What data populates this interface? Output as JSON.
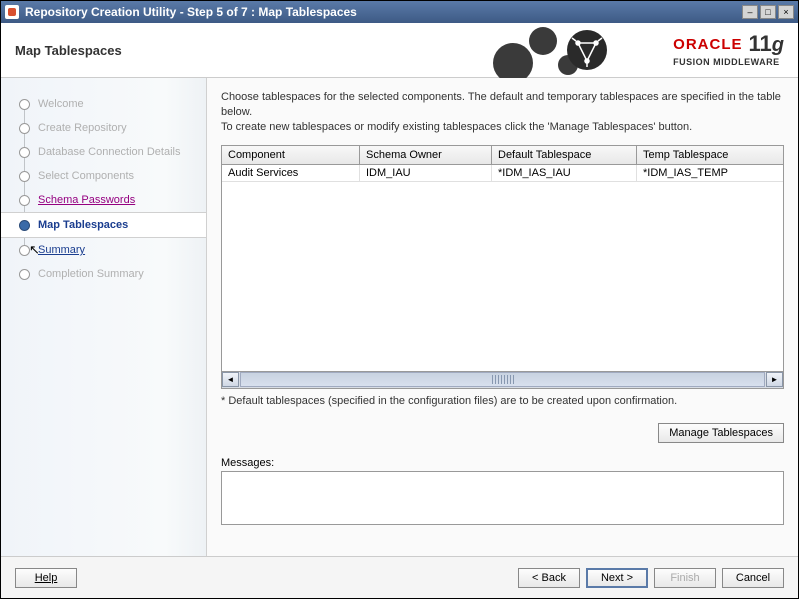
{
  "window": {
    "title": "Repository Creation Utility - Step 5 of 7 : Map Tablespaces"
  },
  "header": {
    "title": "Map Tablespaces",
    "brand": "ORACLE",
    "version": "11",
    "version_suffix": "g",
    "subtitle": "FUSION MIDDLEWARE"
  },
  "steps": [
    {
      "label": "Welcome",
      "state": "completed"
    },
    {
      "label": "Create Repository",
      "state": "completed"
    },
    {
      "label": "Database Connection Details",
      "state": "completed"
    },
    {
      "label": "Select Components",
      "state": "completed"
    },
    {
      "label": "Schema Passwords",
      "state": "link"
    },
    {
      "label": "Map Tablespaces",
      "state": "current"
    },
    {
      "label": "Summary",
      "state": "link summary"
    },
    {
      "label": "Completion Summary",
      "state": "pending"
    }
  ],
  "instructions": {
    "line1": "Choose tablespaces for the selected components. The default and temporary tablespaces are specified in the table below.",
    "line2": "To create new tablespaces or modify existing tablespaces click the 'Manage Tablespaces' button."
  },
  "table": {
    "headers": {
      "component": "Component",
      "owner": "Schema Owner",
      "default_ts": "Default Tablespace",
      "temp_ts": "Temp Tablespace"
    },
    "rows": [
      {
        "component": "Audit Services",
        "owner": "IDM_IAU",
        "default_ts": "*IDM_IAS_IAU",
        "temp_ts": "*IDM_IAS_TEMP"
      }
    ]
  },
  "note": "* Default tablespaces (specified in the configuration files) are to be created upon confirmation.",
  "buttons": {
    "manage": "Manage Tablespaces",
    "help": "Help",
    "back": "< Back",
    "next": "Next >",
    "finish": "Finish",
    "cancel": "Cancel"
  },
  "messages_label": "Messages:"
}
